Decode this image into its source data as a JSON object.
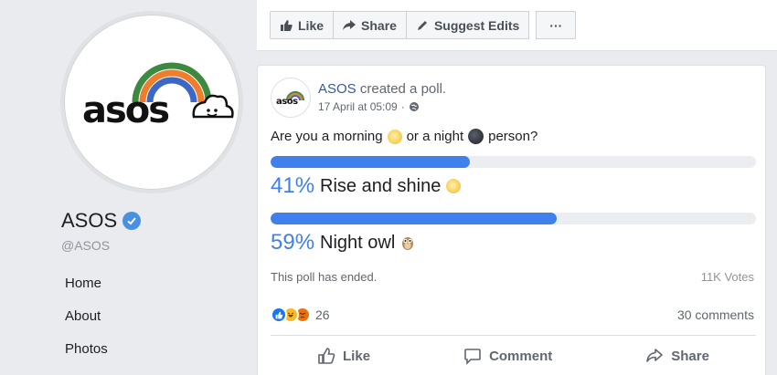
{
  "page": {
    "name": "ASOS",
    "handle": "@ASOS",
    "nav": [
      "Home",
      "About",
      "Photos"
    ]
  },
  "top_bar": {
    "like": "Like",
    "share": "Share",
    "suggest_edits": "Suggest Edits",
    "more": "···"
  },
  "post": {
    "author": "ASOS",
    "action_text": " created a poll.",
    "timestamp": "17 April at 05:09",
    "meta_sep": "·",
    "question": {
      "part1": "Are you a morning",
      "part2": "or a night",
      "part3": "person?"
    },
    "options": [
      {
        "percent": "41%",
        "value": 41,
        "label": "Rise and shine",
        "emoji": "sun"
      },
      {
        "percent": "59%",
        "value": 59,
        "label": "Night owl",
        "emoji": "owl"
      }
    ],
    "status": "This poll has ended.",
    "votes": "11K Votes",
    "reaction_count": "26",
    "comments": "30 comments",
    "actions": {
      "like": "Like",
      "comment": "Comment",
      "share": "Share"
    }
  },
  "colors": {
    "accent": "#4080ec",
    "link": "#385898",
    "verified": "#4a90e2"
  }
}
